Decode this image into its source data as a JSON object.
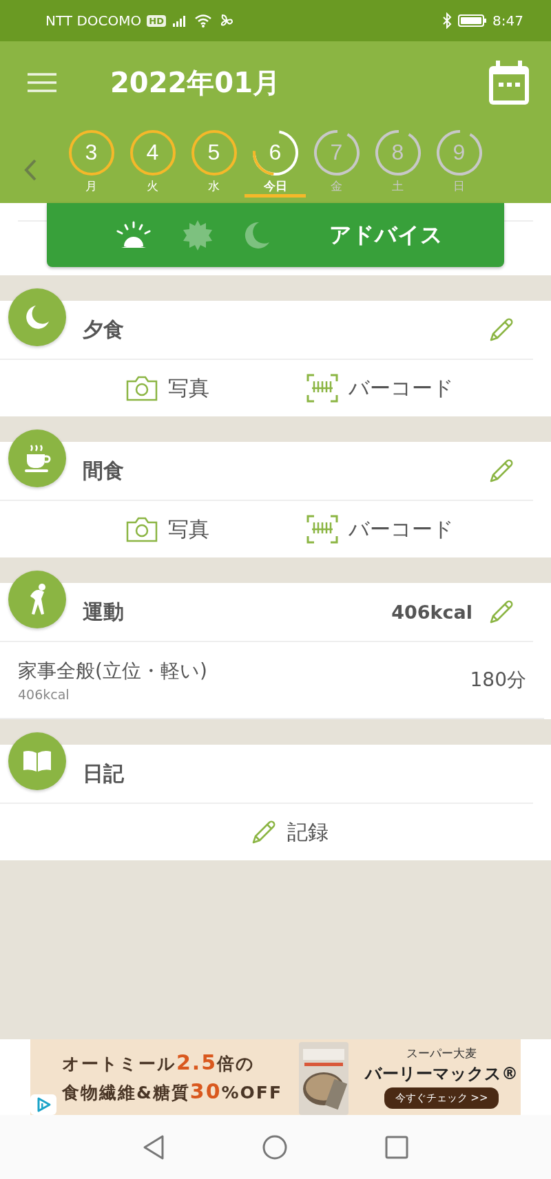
{
  "status_bar": {
    "carrier": "NTT DOCOMO",
    "hd_badge": "HD",
    "time": "8:47"
  },
  "header": {
    "title": "2022年01月"
  },
  "days": [
    {
      "number": "3",
      "label": "月",
      "selected": false,
      "kind": "complete"
    },
    {
      "number": "4",
      "label": "火",
      "selected": false,
      "kind": "complete"
    },
    {
      "number": "5",
      "label": "水",
      "selected": false,
      "kind": "complete"
    },
    {
      "number": "6",
      "label": "今日",
      "selected": true,
      "kind": "partial"
    },
    {
      "number": "7",
      "label": "金",
      "selected": false,
      "kind": "empty"
    },
    {
      "number": "8",
      "label": "土",
      "selected": false,
      "kind": "empty"
    },
    {
      "number": "9",
      "label": "日",
      "selected": false,
      "kind": "empty"
    }
  ],
  "advice": {
    "label": "アドバイス",
    "periods": [
      {
        "kind": "morning",
        "active": true
      },
      {
        "kind": "noon",
        "active": false
      },
      {
        "kind": "night",
        "active": false
      }
    ]
  },
  "sections": [
    {
      "kind": "dinner",
      "title": "夕食",
      "actions": [
        {
          "label": "写真"
        },
        {
          "kind": "barcode",
          "label": "バーコード"
        }
      ]
    },
    {
      "kind": "snack",
      "title": "間食",
      "actions": [
        {
          "label": "写真"
        },
        {
          "kind": "barcode",
          "label": "バーコード"
        }
      ]
    },
    {
      "kind": "exercise",
      "title": "運動",
      "total": "406kcal",
      "items": [
        {
          "name": "家事全般(立位・軽い)",
          "kcal": "406kcal",
          "duration": "180分"
        }
      ]
    },
    {
      "kind": "diary",
      "title": "日記",
      "record": "記録"
    }
  ],
  "ad": {
    "lines": [
      [
        {
          "text": "オートミール",
          "emphasis": false
        },
        {
          "text": "2.5",
          "emphasis": true
        },
        {
          "text": "倍の",
          "emphasis": false
        }
      ],
      [
        {
          "text": "食物繊維&糖質",
          "emphasis": false
        },
        {
          "text": "30",
          "emphasis": true
        },
        {
          "text": "%OFF",
          "emphasis": false
        }
      ]
    ],
    "product": {
      "kind": "picture"
    },
    "brand_sub": "スーパー大麦",
    "brand": "バーリーマックス®",
    "cta": "今すぐチェック >>"
  }
}
